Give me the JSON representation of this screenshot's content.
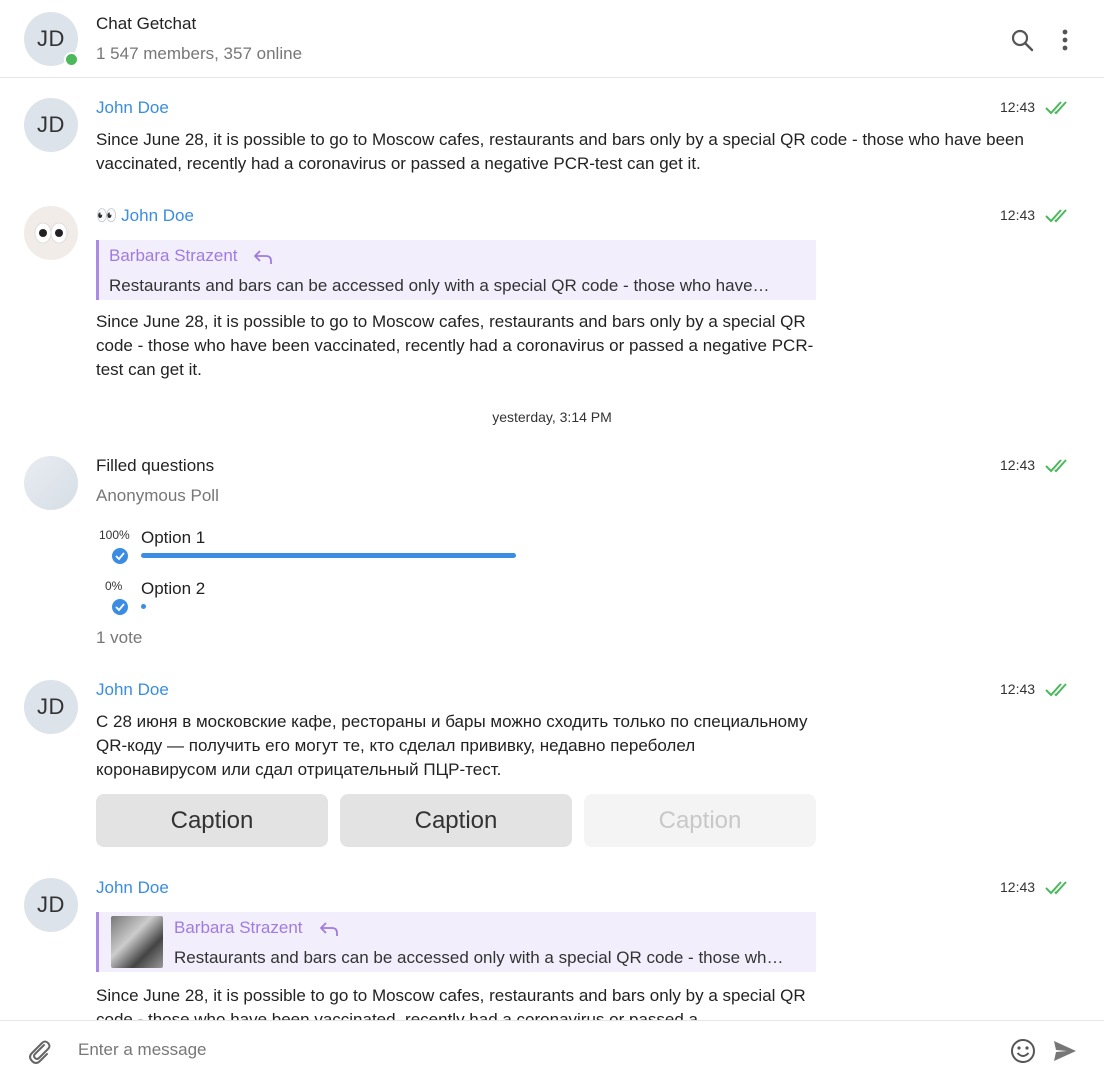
{
  "header": {
    "avatar_initials": "JD",
    "title": "Chat Getchat",
    "subtitle": "1 547 members, 357 online",
    "online_color": "#4cb85c"
  },
  "accent_color": "#3a8de2",
  "messages": [
    {
      "author": "John Doe",
      "avatar": "JD",
      "time": "12:43",
      "text": "Since June 28, it is possible to go to Moscow cafes, restaurants and bars only by a special QR code - those who have been vaccinated, recently had a coronavirus or passed a negative PCR-test can get it."
    },
    {
      "author_prefix": "👀",
      "author": "John Doe",
      "avatar": "eyes-avatar",
      "time": "12:43",
      "reply": {
        "name": "Barbara Strazent",
        "text": "Restaurants and bars can be accessed only with a special QR code - those who have…"
      },
      "text": "Since June 28, it is possible to go to Moscow cafes, restaurants and bars only by a special QR code - those who have been vaccinated, recently had a coronavirus or passed a negative PCR-test can get it."
    }
  ],
  "date_separator": "yesterday, 3:14 PM",
  "poll": {
    "time": "12:43",
    "title": "Filled questions",
    "type": "Anonymous Poll",
    "options": [
      {
        "pct_label": "100%",
        "label": "Option 1",
        "share": 1.0
      },
      {
        "pct_label": "0%",
        "label": "Option 2",
        "share": 0.0
      }
    ],
    "votes": "1 vote"
  },
  "message_ru": {
    "author": "John Doe",
    "avatar": "JD",
    "time": "12:43",
    "text": "С 28 июня в московские кафе, рестораны и бары можно сходить только по специальному QR-коду — получить его могут те, кто сделал прививку, недавно переболел коронавирусом или сдал отрицательный ПЦР-тест.",
    "buttons": [
      {
        "label": "Caption",
        "enabled": true
      },
      {
        "label": "Caption",
        "enabled": true
      },
      {
        "label": "Caption",
        "enabled": false
      }
    ]
  },
  "message_last": {
    "author": "John Doe",
    "avatar": "JD",
    "time": "12:43",
    "reply": {
      "name": "Barbara Strazent",
      "text": "Restaurants and bars can be accessed only with a special QR code - those wh…"
    },
    "text": "Since June 28, it is possible to go to Moscow cafes, restaurants and bars only by a special QR code - those who have been vaccinated, recently had a coronavirus or passed a"
  },
  "composer": {
    "placeholder": "Enter a message"
  },
  "icons": {
    "search": "search-icon",
    "menu": "more-vertical-icon",
    "attach": "paperclip-icon",
    "emoji": "emoji-icon",
    "send": "send-icon",
    "read": "double-check-icon",
    "reply": "reply-arrow-icon"
  }
}
